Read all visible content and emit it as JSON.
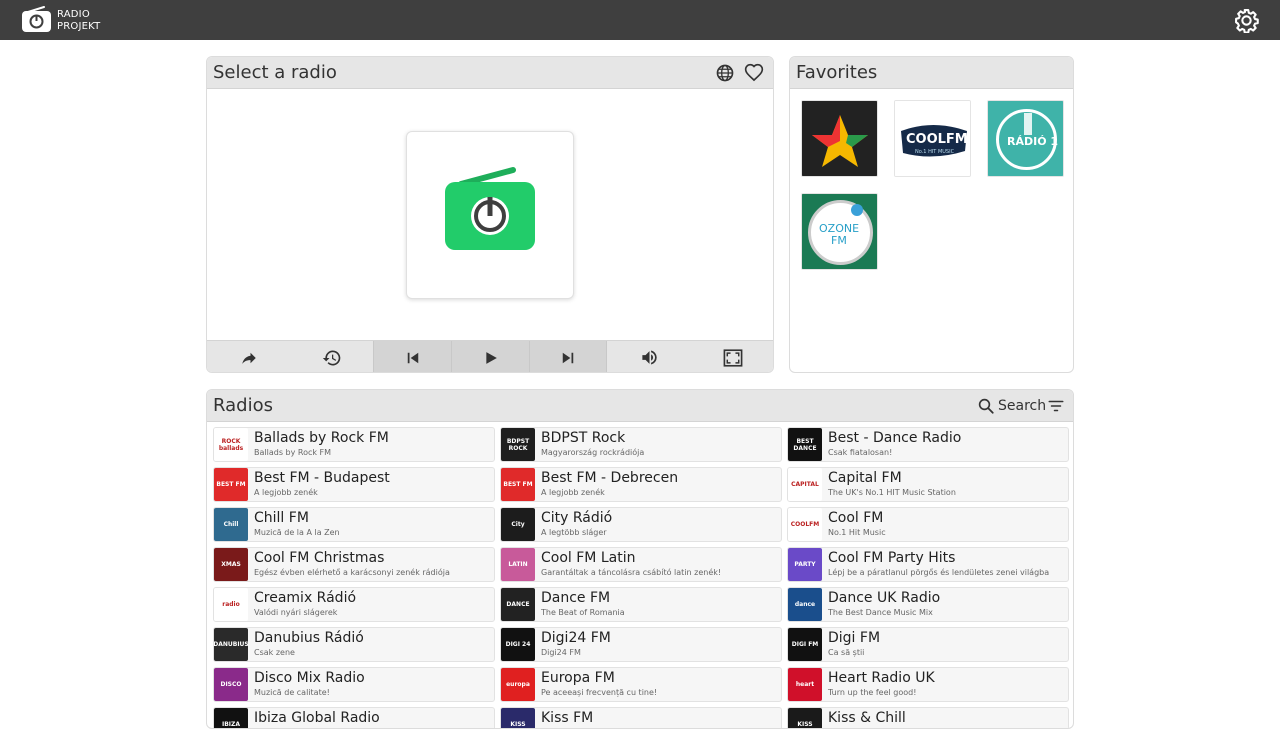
{
  "app": {
    "brand_line1": "RADIO",
    "brand_line2": "PROJEKT"
  },
  "player": {
    "title": "Select a radio",
    "controls": [
      "share",
      "history",
      "previous",
      "play",
      "next",
      "volume",
      "fullscreen"
    ]
  },
  "favorites": {
    "title": "Favorites",
    "items": [
      "Star radio",
      "Cool FM",
      "Rádió 1",
      "Ozone FM"
    ]
  },
  "radios": {
    "title": "Radios",
    "search_label": "Search",
    "items": [
      {
        "name": "Ballads by Rock FM",
        "desc": "Ballads by Rock FM",
        "color": "#ffffff",
        "thumb": "ROCK ballads"
      },
      {
        "name": "BDPST Rock",
        "desc": "Magyarország rockrádiója",
        "color": "#1e1e1e",
        "thumb": "BDPST ROCK"
      },
      {
        "name": "Best - Dance Radio",
        "desc": "Csak fiatalosan!",
        "color": "#111111",
        "thumb": "BEST DANCE"
      },
      {
        "name": "Best FM - Budapest",
        "desc": "A legjobb zenék",
        "color": "#e02a2a",
        "thumb": "BEST FM"
      },
      {
        "name": "Best FM - Debrecen",
        "desc": "A legjobb zenék",
        "color": "#e02a2a",
        "thumb": "BEST FM"
      },
      {
        "name": "Capital FM",
        "desc": "The UK's No.1 HIT Music Station",
        "color": "#ffffff",
        "thumb": "CAPITAL"
      },
      {
        "name": "Chill FM",
        "desc": "Muzică de la A la Zen",
        "color": "#2f6a8f",
        "thumb": "Chill"
      },
      {
        "name": "City Rádió",
        "desc": "A legtöbb sláger",
        "color": "#1c1c1c",
        "thumb": "City"
      },
      {
        "name": "Cool FM",
        "desc": "No.1 Hit Music",
        "color": "#ffffff",
        "thumb": "COOLFM"
      },
      {
        "name": "Cool FM Christmas",
        "desc": "Egész évben elérhető a karácsonyi zenék rádiója",
        "color": "#7a1a1a",
        "thumb": "XMAS"
      },
      {
        "name": "Cool FM Latin",
        "desc": "Garantáltak a táncolásra csábító latin zenék!",
        "color": "#c85a9a",
        "thumb": "LATIN"
      },
      {
        "name": "Cool FM Party Hits",
        "desc": "Lépj be a páratlanul pörgős és lendületes zenei világba",
        "color": "#6a4ac8",
        "thumb": "PARTY"
      },
      {
        "name": "Creamix Rádió",
        "desc": "Valódi nyári slágerek",
        "color": "#ffffff",
        "thumb": "radio"
      },
      {
        "name": "Dance FM",
        "desc": "The Beat of Romania",
        "color": "#222222",
        "thumb": "DANCE"
      },
      {
        "name": "Dance UK Radio",
        "desc": "The Best Dance Music Mix",
        "color": "#1a4e8c",
        "thumb": "dance"
      },
      {
        "name": "Danubius Rádió",
        "desc": "Csak zene",
        "color": "#2a2a2a",
        "thumb": "DANUBIUS"
      },
      {
        "name": "Digi24 FM",
        "desc": "Digi24 FM",
        "color": "#111111",
        "thumb": "DIGI 24"
      },
      {
        "name": "Digi FM",
        "desc": "Ca să știi",
        "color": "#111111",
        "thumb": "DIGI FM"
      },
      {
        "name": "Disco Mix Radio",
        "desc": "Muzică de calitate!",
        "color": "#8a2a8a",
        "thumb": "DISCO"
      },
      {
        "name": "Europa FM",
        "desc": "Pe aceeași frecvență cu tine!",
        "color": "#e02020",
        "thumb": "europa"
      },
      {
        "name": "Heart Radio UK",
        "desc": "Turn up the feel good!",
        "color": "#d0102a",
        "thumb": "heart"
      },
      {
        "name": "Ibiza Global Radio",
        "desc": "",
        "color": "#111111",
        "thumb": "IBIZA"
      },
      {
        "name": "Kiss FM",
        "desc": "",
        "color": "#2a2a6a",
        "thumb": "KISS"
      },
      {
        "name": "Kiss & Chill",
        "desc": "",
        "color": "#1a1a1a",
        "thumb": "KISS"
      }
    ]
  }
}
